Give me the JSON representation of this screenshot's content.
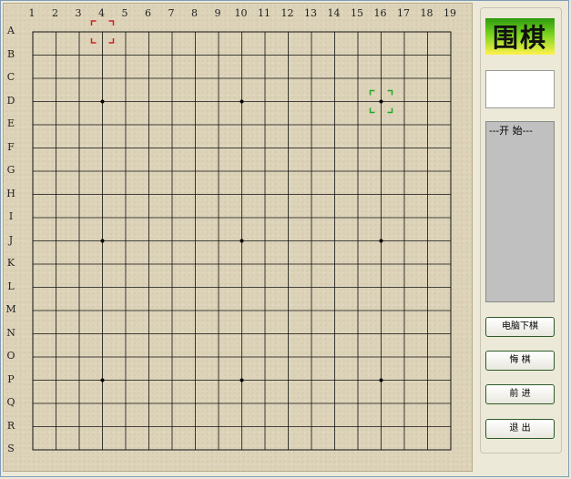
{
  "board": {
    "size": 19,
    "column_labels": [
      "1",
      "2",
      "3",
      "4",
      "5",
      "6",
      "7",
      "8",
      "9",
      "10",
      "11",
      "12",
      "13",
      "14",
      "15",
      "16",
      "17",
      "18",
      "19"
    ],
    "row_labels": [
      "A",
      "B",
      "C",
      "D",
      "E",
      "F",
      "G",
      "H",
      "I",
      "J",
      "K",
      "L",
      "M",
      "N",
      "O",
      "P",
      "Q",
      "R",
      "S"
    ],
    "star_points": [
      [
        4,
        4
      ],
      [
        10,
        4
      ],
      [
        16,
        4
      ],
      [
        4,
        10
      ],
      [
        10,
        10
      ],
      [
        16,
        10
      ],
      [
        4,
        16
      ],
      [
        10,
        16
      ],
      [
        16,
        16
      ]
    ],
    "red_marker": {
      "col": 4,
      "row": 1,
      "color": "#d02020"
    },
    "green_marker": {
      "col": 16,
      "row": 4,
      "color": "#22aa22"
    },
    "line_color": "#111111"
  },
  "side": {
    "logo": "围棋",
    "log_start": "---开 始---",
    "buttons": {
      "computer_move": "电脑下棋",
      "undo": "悔 棋",
      "forward": "前 进",
      "exit": "退 出"
    }
  }
}
